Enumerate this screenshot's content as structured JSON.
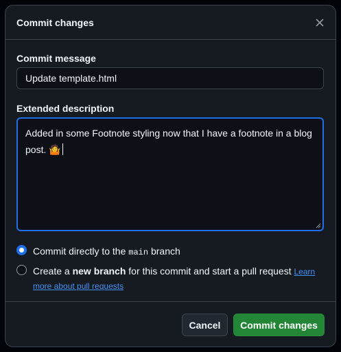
{
  "dialog": {
    "title": "Commit changes",
    "close_icon": "close-icon"
  },
  "commit_message": {
    "label": "Commit message",
    "value": "Update template.html"
  },
  "extended_description": {
    "label": "Extended description",
    "value": "Added in some Footnote styling now that I have a footnote in a blog post. 🤷"
  },
  "branch_options": {
    "direct": {
      "prefix": "Commit directly to the ",
      "branch": "main",
      "suffix": " branch",
      "selected": true
    },
    "new_branch": {
      "prefix": "Create a ",
      "strong": "new branch",
      "suffix": " for this commit and start a pull request ",
      "link": "Learn more about pull requests",
      "selected": false
    }
  },
  "footer": {
    "cancel_label": "Cancel",
    "commit_label": "Commit changes"
  },
  "colors": {
    "accent": "#1f6feb",
    "primary_button": "#238636",
    "link": "#4493f8"
  }
}
